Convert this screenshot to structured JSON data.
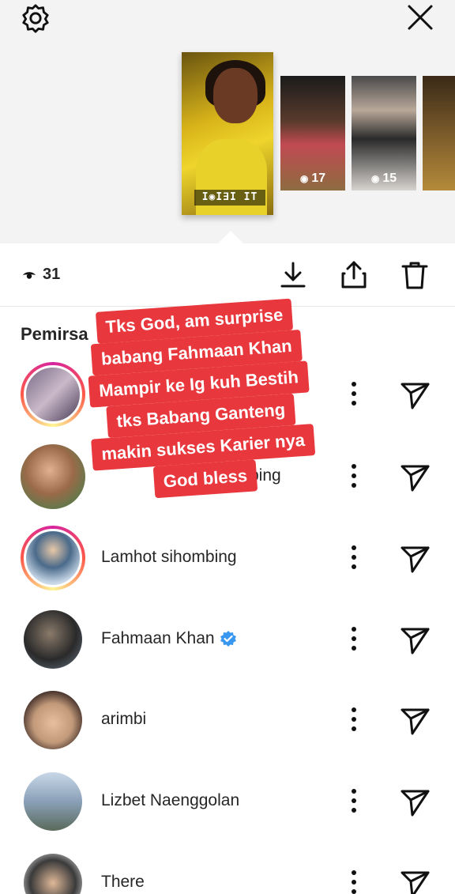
{
  "tray": {
    "thumbnails": [
      {
        "views": "",
        "overlay_text": "I◉I∃I IT"
      },
      {
        "views": "17"
      },
      {
        "views": "15"
      },
      {
        "views": ""
      }
    ]
  },
  "actions": {
    "view_count": "31",
    "icons": [
      "eye-icon",
      "download-icon",
      "share-icon",
      "trash-icon"
    ]
  },
  "viewers": {
    "section_title": "Pemirsa",
    "items": [
      {
        "name": "",
        "ring": true,
        "avatar_color": "#7a6a86",
        "verified": false
      },
      {
        "name": "Lamhot sihombing",
        "ring": false,
        "avatar_color": "#9a6a4a",
        "verified": false,
        "partial_visible": "bing"
      },
      {
        "name": "Lamhot sihombing",
        "ring": true,
        "avatar_color": "#4a6a8a",
        "verified": false
      },
      {
        "name": "Fahmaan Khan",
        "ring": false,
        "avatar_color": "#2a2a2a",
        "verified": true
      },
      {
        "name": "arimbi",
        "ring": false,
        "avatar_color": "#c29a7a",
        "verified": false
      },
      {
        "name": "Lizbet Naenggolan",
        "ring": false,
        "avatar_color": "#8aa0b8",
        "verified": false
      },
      {
        "name": "There",
        "ring": false,
        "avatar_color": "#3a3a3a",
        "verified": false
      }
    ]
  },
  "caption": {
    "lines": [
      "Tks God, am surprise",
      "babang Fahmaan Khan",
      "Mampir ke Ig kuh Bestih",
      "tks Babang Ganteng",
      "makin sukses Karier nya",
      "God bless"
    ],
    "color": "#e8383d"
  },
  "colors": {
    "verified_blue": "#3897f0",
    "text": "#262626"
  }
}
